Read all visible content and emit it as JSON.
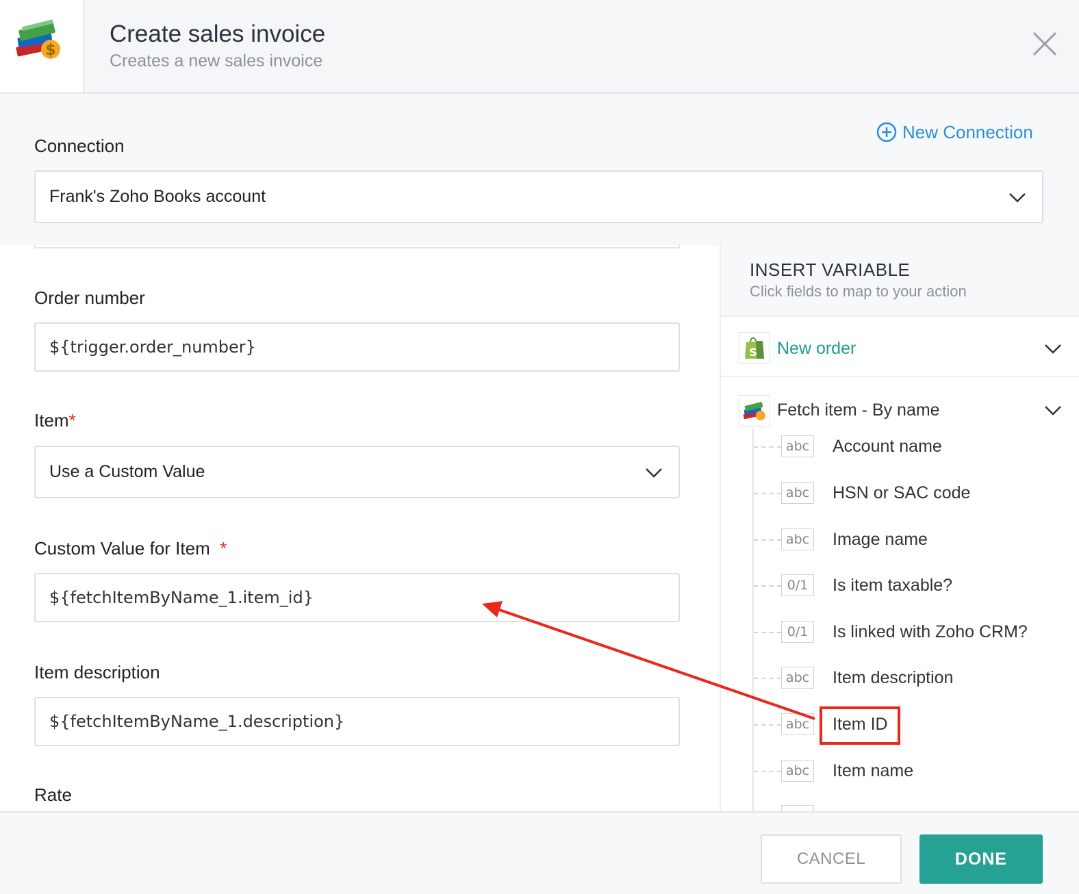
{
  "header": {
    "title": "Create sales invoice",
    "subtitle": "Creates a new sales invoice"
  },
  "connection": {
    "label": "Connection",
    "new_connection": "New Connection",
    "selected": "Frank's Zoho Books account"
  },
  "form": {
    "order_number": {
      "label": "Order number",
      "value": "${trigger.order_number}"
    },
    "item": {
      "label": "Item",
      "required_mark": "*",
      "selected": "Use a Custom Value"
    },
    "custom_value": {
      "label": "Custom Value for Item",
      "required_mark": "*",
      "value": "${fetchItemByName_1.item_id}"
    },
    "item_description": {
      "label": "Item description",
      "value": "${fetchItemByName_1.description}"
    },
    "rate": {
      "label": "Rate"
    }
  },
  "insert_variable": {
    "title": "INSERT VARIABLE",
    "subtitle": "Click fields to map to your action",
    "groups": [
      {
        "name": "New order",
        "icon": "shopify-bag-icon",
        "color": "#1e9e8e"
      },
      {
        "name": "Fetch item - By name",
        "icon": "zoho-books-icon",
        "color": "#333333"
      }
    ],
    "variables": [
      {
        "type": "abc",
        "name": "Account name"
      },
      {
        "type": "abc",
        "name": "HSN or SAC code"
      },
      {
        "type": "abc",
        "name": "Image name"
      },
      {
        "type": "0/1",
        "name": "Is item taxable?"
      },
      {
        "type": "0/1",
        "name": "Is linked with Zoho CRM?"
      },
      {
        "type": "abc",
        "name": "Item description"
      },
      {
        "type": "abc",
        "name": "Item ID"
      },
      {
        "type": "abc",
        "name": "Item name"
      }
    ]
  },
  "footer": {
    "cancel": "CANCEL",
    "done": "DONE"
  },
  "colors": {
    "accent_blue": "#2b8ed6",
    "accent_teal": "#26a294",
    "highlight_red": "#e8291c"
  }
}
